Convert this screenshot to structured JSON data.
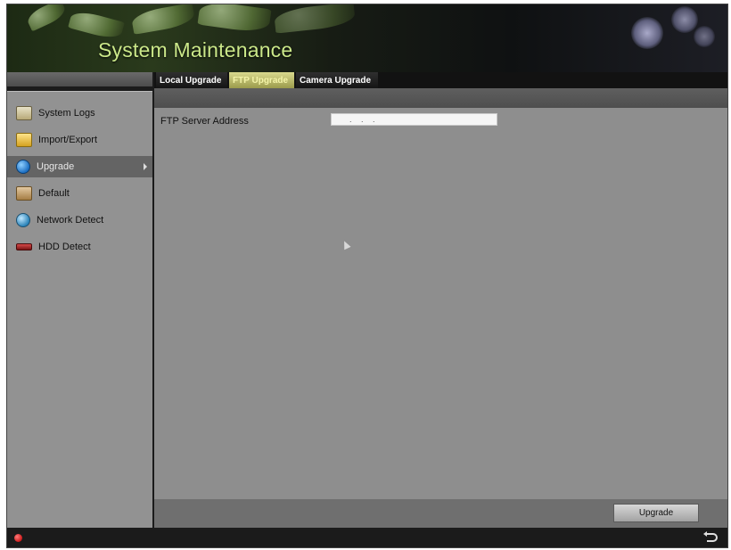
{
  "app": {
    "title": "System Maintenance"
  },
  "sidebar": {
    "items": [
      {
        "label": "System Logs",
        "icon": "log-icon",
        "active": false
      },
      {
        "label": "Import/Export",
        "icon": "folder-icon",
        "active": false
      },
      {
        "label": "Upgrade",
        "icon": "upgrade-icon",
        "active": true
      },
      {
        "label": "Default",
        "icon": "default-icon",
        "active": false
      },
      {
        "label": "Network Detect",
        "icon": "network-icon",
        "active": false
      },
      {
        "label": "HDD Detect",
        "icon": "hdd-icon",
        "active": false
      }
    ]
  },
  "tabs": [
    {
      "label": "Local Upgrade",
      "active": false
    },
    {
      "label": "FTP Upgrade",
      "active": true
    },
    {
      "label": "Camera Upgrade",
      "active": false
    }
  ],
  "ftp": {
    "label": "FTP Server Address",
    "value": ". . ."
  },
  "footer": {
    "upgrade_label": "Upgrade"
  },
  "colors": {
    "title": "#cbe889",
    "active_tab": "#f3f3a7",
    "active_nav_bg": "#646464"
  }
}
